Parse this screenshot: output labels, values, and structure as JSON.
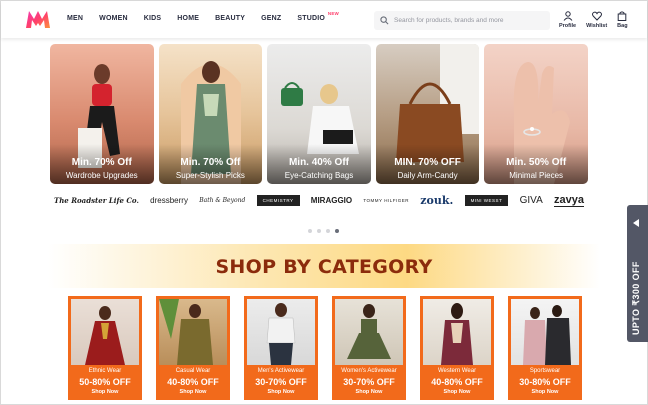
{
  "header": {
    "nav": [
      "MEN",
      "WOMEN",
      "KIDS",
      "HOME",
      "BEAUTY",
      "GENZ",
      "STUDIO"
    ],
    "studio_badge": "NEW",
    "search_placeholder": "Search for products, brands and more",
    "actions": [
      {
        "label": "Profile",
        "icon": "profile-icon"
      },
      {
        "label": "Wishlist",
        "icon": "heart-icon"
      },
      {
        "label": "Bag",
        "icon": "bag-icon"
      }
    ]
  },
  "banners": [
    {
      "offer": "Min. 70% Off",
      "subtitle": "Wardrobe Upgrades"
    },
    {
      "offer": "Min. 70% Off",
      "subtitle": "Super-Stylish Picks"
    },
    {
      "offer": "Min. 40% Off",
      "subtitle": "Eye-Catching Bags"
    },
    {
      "offer": "MIN. 70% OFF",
      "subtitle": "Daily Arm-Candy"
    },
    {
      "offer": "Min. 50% Off",
      "subtitle": "Minimal Pieces"
    }
  ],
  "brands": [
    "The Roadster Life Co.",
    "dressberry",
    "Bath & Beyond",
    "CHEMISTRY",
    "MIRAGGIO",
    "TOMMY HILFIGER",
    "zouk.",
    "MINI WESST",
    "GIVA",
    "zavya"
  ],
  "carousel": {
    "total": 4,
    "active_index": 3
  },
  "category": {
    "title": "SHOP BY CATEGORY",
    "items": [
      {
        "label": "Ethnic Wear",
        "offer": "50-80% OFF",
        "cta": "Shop Now"
      },
      {
        "label": "Casual Wear",
        "offer": "40-80% OFF",
        "cta": "Shop Now"
      },
      {
        "label": "Men's Activewear",
        "offer": "30-70% OFF",
        "cta": "Shop Now"
      },
      {
        "label": "Women's Activewear",
        "offer": "30-70% OFF",
        "cta": "Shop Now"
      },
      {
        "label": "Western Wear",
        "offer": "40-80% OFF",
        "cta": "Shop Now"
      },
      {
        "label": "Sportswear",
        "offer": "30-80% OFF",
        "cta": "Shop Now"
      }
    ]
  },
  "side_tab": {
    "label": "UPTO ₹300 OFF"
  },
  "colors": {
    "brand_pink": "#ff3f6c",
    "category_orange": "#f26a1b",
    "category_title": "#8b2b0c",
    "side_tab": "#535766"
  }
}
